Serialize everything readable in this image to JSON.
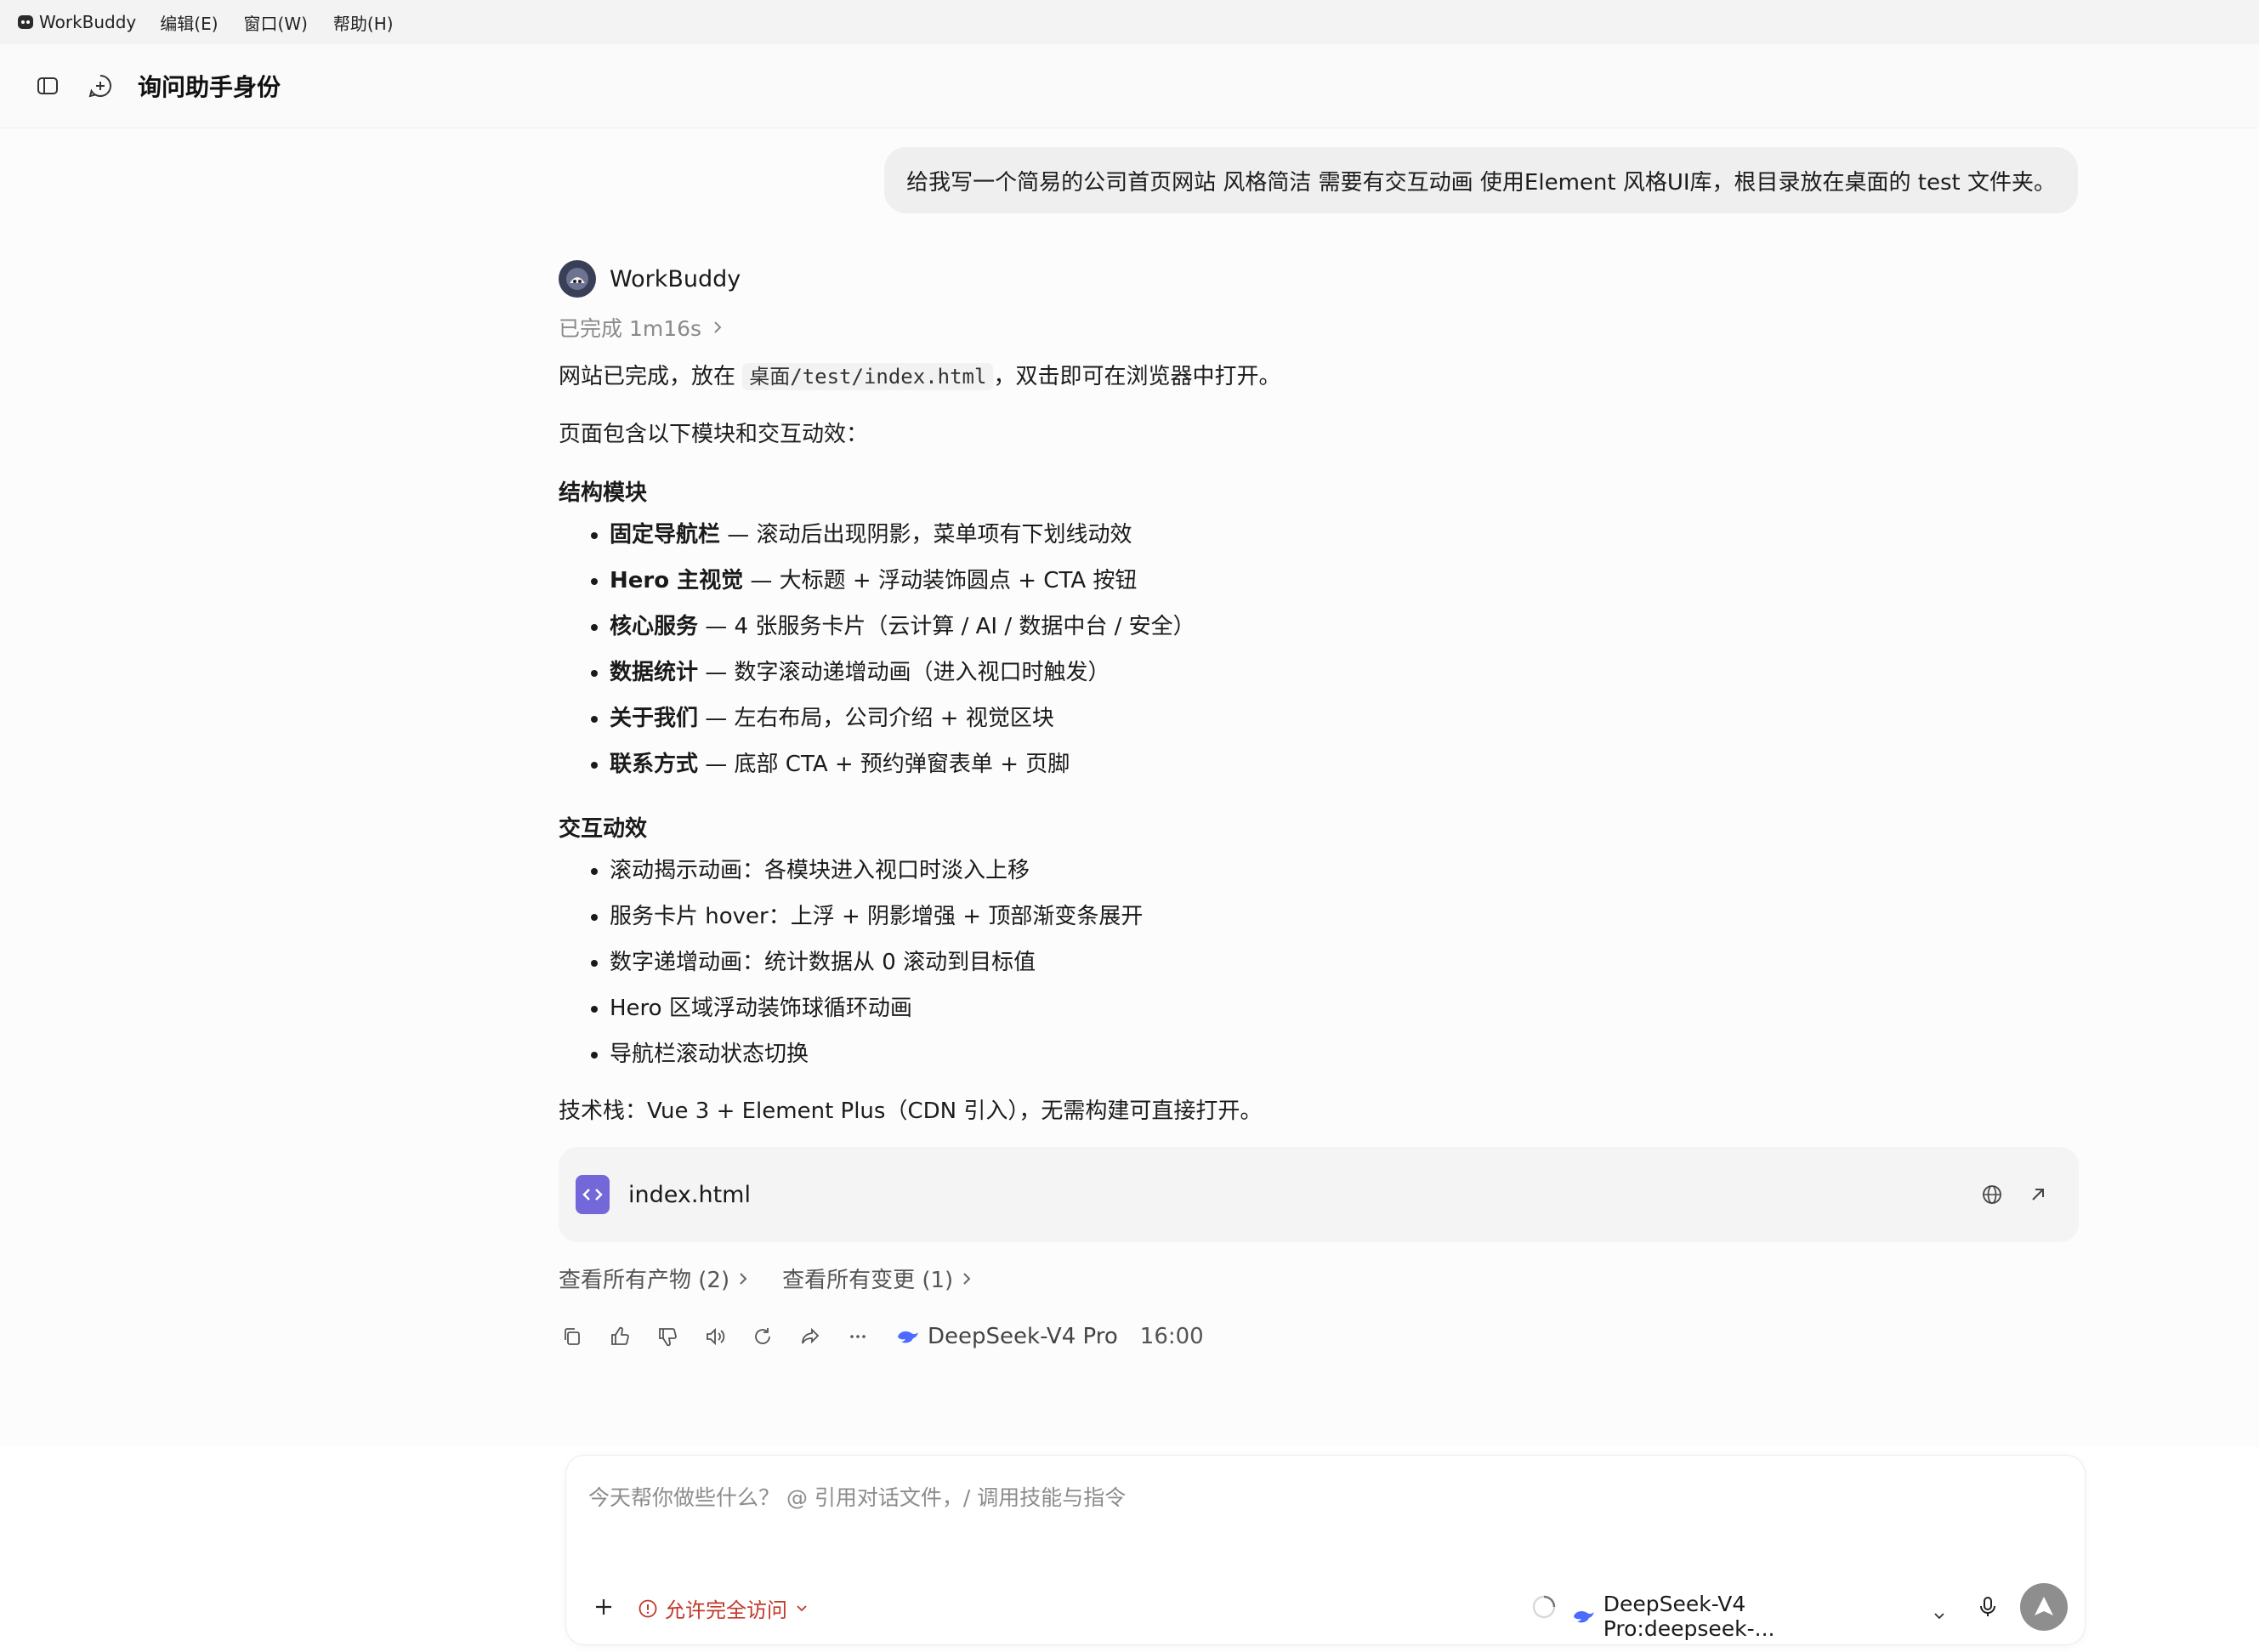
{
  "menubar": {
    "app_name": "WorkBuddy",
    "items": [
      "编辑(E)",
      "窗口(W)",
      "帮助(H)"
    ]
  },
  "header": {
    "title": "询问助手身份",
    "sidebar_toggle_icon": "sidebar-toggle-icon",
    "new_chat_icon": "new-chat-icon"
  },
  "user_message": "给我写一个简易的公司首页网站 风格简洁 需要有交互动画 使用Element 风格UI库，根目录放在桌面的 test 文件夹。",
  "assistant": {
    "name": "WorkBuddy",
    "status": "已完成 1m16s",
    "intro_prefix": "网站已完成，放在 ",
    "intro_code": "桌面/test/index.html",
    "intro_suffix": "，双击即可在浏览器中打开。",
    "contains": "页面包含以下模块和交互动效：",
    "section1_title": "结构模块",
    "section1_items": [
      {
        "bold": "固定导航栏",
        "text": " — 滚动后出现阴影，菜单项有下划线动效"
      },
      {
        "bold": "Hero 主视觉",
        "text": " — 大标题 + 浮动装饰圆点 + CTA 按钮"
      },
      {
        "bold": "核心服务",
        "text": " — 4 张服务卡片（云计算 / AI / 数据中台 / 安全）"
      },
      {
        "bold": "数据统计",
        "text": " — 数字滚动递增动画（进入视口时触发）"
      },
      {
        "bold": "关于我们",
        "text": " — 左右布局，公司介绍 + 视觉区块"
      },
      {
        "bold": "联系方式",
        "text": " — 底部 CTA + 预约弹窗表单 + 页脚"
      }
    ],
    "section2_title": "交互动效",
    "section2_items": [
      "滚动揭示动画：各模块进入视口时淡入上移",
      "服务卡片 hover：上浮 + 阴影增强 + 顶部渐变条展开",
      "数字递增动画：统计数据从 0 滚动到目标值",
      "Hero 区域浮动装饰球循环动画",
      "导航栏滚动状态切换"
    ],
    "tech_stack": "技术栈：Vue 3 + Element Plus（CDN 引入），无需构建可直接打开。",
    "file_card": {
      "name": "index.html"
    },
    "links": {
      "artifacts": "查看所有产物 (2)",
      "changes": "查看所有变更 (1)"
    },
    "model": "DeepSeek-V4 Pro",
    "time": "16:00"
  },
  "input": {
    "placeholder": "今天帮你做些什么？ @ 引用对话文件，/ 调用技能与指令",
    "value": "",
    "access_label": "允许完全访问",
    "model_select": "DeepSeek-V4 Pro:deepseek-..."
  },
  "colors": {
    "accent_purple": "#7367d9",
    "warning_red": "#c0392b",
    "send_button_gray": "#8e8e8e",
    "deepseek_blue": "#4d6bfe"
  }
}
